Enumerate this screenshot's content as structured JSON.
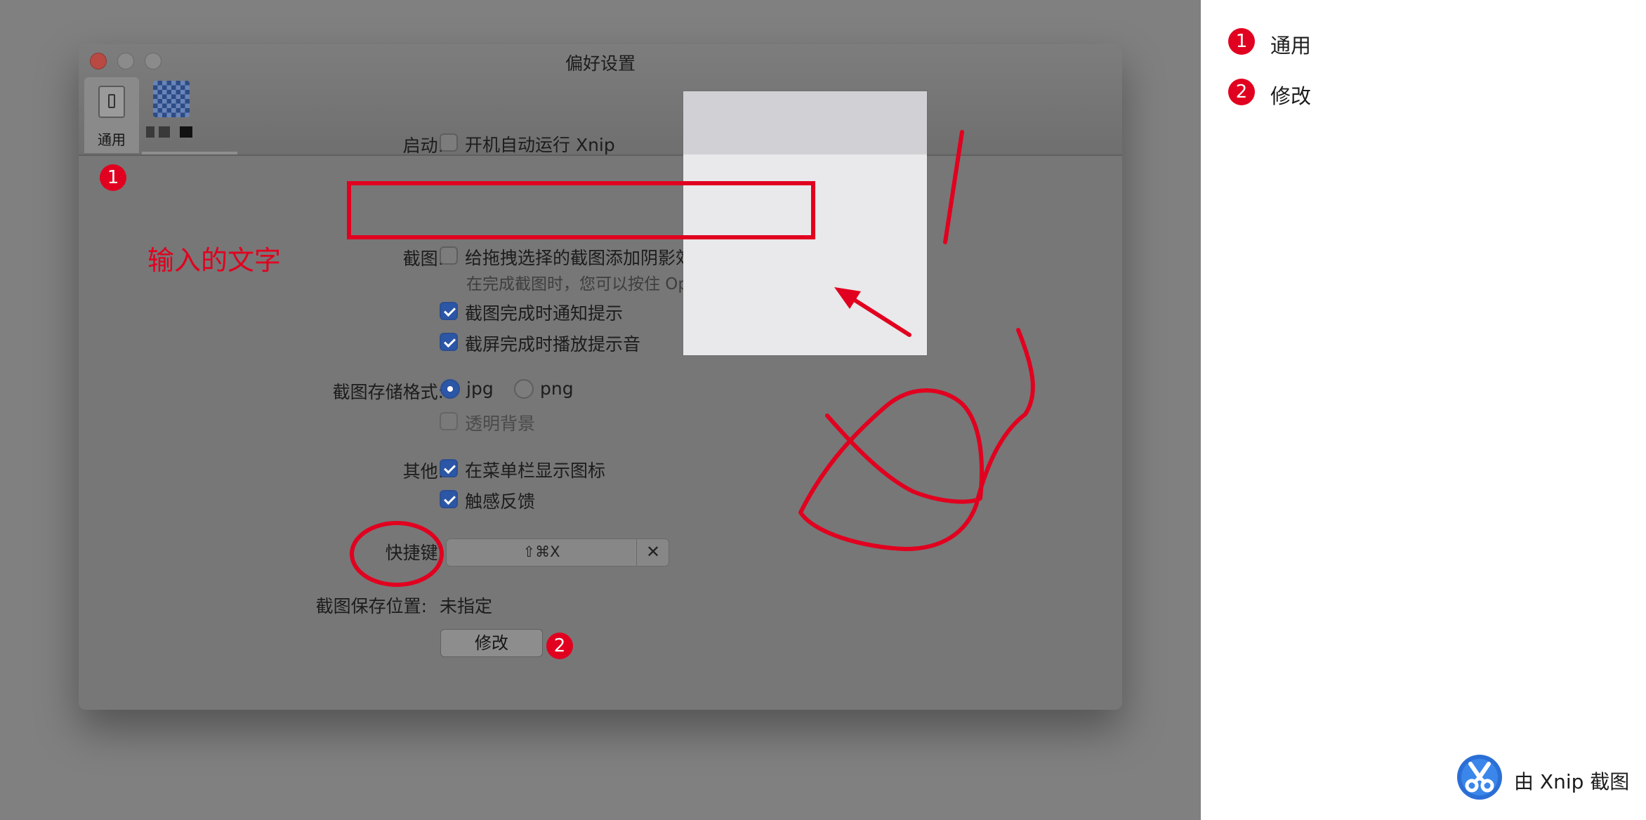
{
  "window": {
    "title": "偏好设置",
    "toolbar": {
      "general_label": "通用"
    }
  },
  "startup": {
    "label": "启动:",
    "launch_at_login": {
      "text": "开机自动运行 Xnip",
      "checked": false
    }
  },
  "screenshot": {
    "label": "截图:",
    "shadow": {
      "text": "给拖拽选择的截图添加阴影效果",
      "checked": false
    },
    "hint": "在完成截图时，您可以按住 Option 以切换。",
    "notify": {
      "text": "截图完成时通知提示",
      "checked": true
    },
    "sound": {
      "text": "截屏完成时播放提示音",
      "checked": true
    }
  },
  "format": {
    "label": "截图存储格式:",
    "options": [
      {
        "text": "jpg",
        "selected": true
      },
      {
        "text": "png",
        "selected": false
      }
    ],
    "transparent": {
      "text": "透明背景",
      "checked": false,
      "disabled": true
    }
  },
  "other": {
    "label": "其他:",
    "menubar_icon": {
      "text": "在菜单栏显示图标",
      "checked": true
    },
    "haptic": {
      "text": "触感反馈",
      "checked": true
    }
  },
  "hotkey": {
    "label": "快捷键:",
    "keys": "⇧⌘X",
    "clear": "✕"
  },
  "save_location": {
    "label": "截图保存位置:",
    "value": "未指定",
    "modify_button": "修改"
  },
  "annotations": {
    "text": "输入的文字",
    "badge_1": "1",
    "badge_2": "2",
    "color": "#e1001f"
  },
  "legend": [
    {
      "number": "1",
      "label": "通用"
    },
    {
      "number": "2",
      "label": "修改"
    }
  ],
  "credit": {
    "text": "由 Xnip 截图"
  }
}
